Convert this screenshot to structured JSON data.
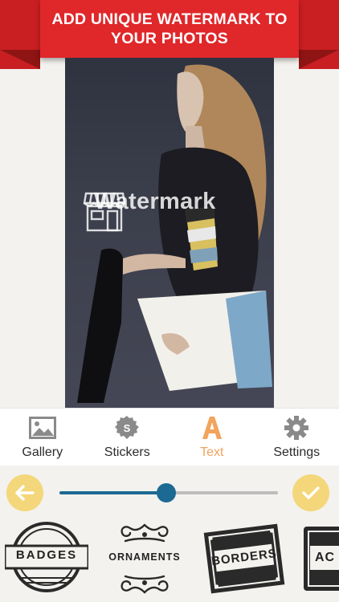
{
  "banner": {
    "text": "ADD UNIQUE WATERMARK TO YOUR PHOTOS"
  },
  "watermark": {
    "text": "Watermark",
    "icon": "storefront-icon"
  },
  "toolbar": {
    "items": [
      {
        "label": "Gallery",
        "icon": "image-icon",
        "active": false
      },
      {
        "label": "Stickers",
        "icon": "sticker-badge-icon",
        "active": false
      },
      {
        "label": "Text",
        "icon": "letter-a-icon",
        "active": true
      },
      {
        "label": "Settings",
        "icon": "gear-icon",
        "active": false
      }
    ],
    "active_color": "#f2a35c"
  },
  "slider": {
    "value": 0.49,
    "accent": "#1c6a93"
  },
  "buttons": {
    "back_icon": "arrow-left-icon",
    "confirm_icon": "checkmark-icon",
    "color": "#f4d77a"
  },
  "categories": [
    {
      "label": "BADGES"
    },
    {
      "label": "ORNAMENTS"
    },
    {
      "label": "BORDERS"
    },
    {
      "label": "AC"
    }
  ],
  "colors": {
    "banner": "#e0272a",
    "background": "#f3f2ee"
  }
}
